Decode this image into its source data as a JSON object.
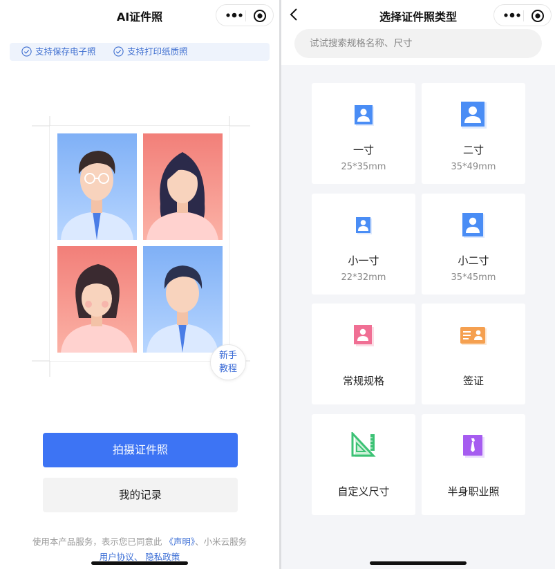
{
  "left": {
    "title": "AI证件照",
    "features": [
      "支持保存电子照",
      "支持打印纸质照"
    ],
    "guide": [
      "新手",
      "教程"
    ],
    "primary_button": "拍摄证件照",
    "secondary_button": "我的记录",
    "footer": {
      "prefix": "使用本产品服务，表示您已同意此",
      "statement": "《声明》",
      "suffix": "、小米云服务",
      "user_agreement": "用户协议",
      "separator": "、",
      "privacy": "隐私政策"
    }
  },
  "right": {
    "title": "选择证件照类型",
    "search_placeholder": "试试搜索规格名称、尺寸",
    "cards": [
      {
        "name": "一寸",
        "size": "25*35mm",
        "icon": "person-photo-icon"
      },
      {
        "name": "二寸",
        "size": "35*49mm",
        "icon": "person-photo-icon"
      },
      {
        "name": "小一寸",
        "size": "22*32mm",
        "icon": "person-photo-icon"
      },
      {
        "name": "小二寸",
        "size": "35*45mm",
        "icon": "person-photo-icon"
      },
      {
        "name": "常规规格",
        "icon": "pink-photo-icon"
      },
      {
        "name": "签证",
        "icon": "id-card-icon"
      },
      {
        "name": "自定义尺寸",
        "icon": "ruler-triangle-icon"
      },
      {
        "name": "半身职业照",
        "icon": "tie-icon"
      }
    ]
  },
  "colors": {
    "primary": "#3d74f4",
    "link": "#3d6fd6",
    "feature_bg": "#eef3fc"
  }
}
